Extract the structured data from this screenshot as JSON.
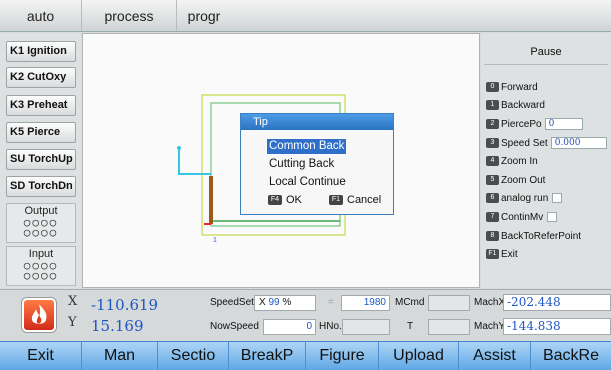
{
  "top_tabs": [
    "auto",
    "process",
    "progr"
  ],
  "left_buttons": [
    "K1 Ignition",
    "K2 CutOxy",
    "K3 Preheat",
    "K5 Pierce",
    "SU TorchUp",
    "SD TorchDn"
  ],
  "output": {
    "label": "Output",
    "dots": "○○○○\n○○○○"
  },
  "input": {
    "label": "Input",
    "dots": "○○○○\n○○○○"
  },
  "canvas": {
    "start_marker": "1"
  },
  "tip_dialog": {
    "title": "Tip",
    "options": [
      "Common Back",
      "Cutting Back",
      "Local Continue"
    ],
    "selected": "Common Back",
    "ok_key": "F4",
    "ok_label": "OK",
    "cancel_key": "F1",
    "cancel_label": "Cancel"
  },
  "right_panel": {
    "title": "Pause",
    "items": [
      {
        "key": "0",
        "label": "Forward"
      },
      {
        "key": "1",
        "label": "Backward"
      },
      {
        "key": "2",
        "label": "PiercePo",
        "value": "0"
      },
      {
        "key": "3",
        "label": "Speed Set",
        "value": "0.000"
      },
      {
        "key": "4",
        "label": "Zoom In"
      },
      {
        "key": "5",
        "label": "Zoom Out"
      },
      {
        "key": "6",
        "label": "analog run"
      },
      {
        "key": "7",
        "label": "ContinMv"
      },
      {
        "key": "8",
        "label": "BackToReferPoint"
      },
      {
        "key": "F1",
        "label": "Exit"
      }
    ]
  },
  "status": {
    "x_label": "X",
    "y_label": "Y",
    "x_value": "-110.619",
    "y_value": "15.169",
    "speedset_label": "SpeedSet",
    "speedset_x": "X",
    "speedset_pct": "99",
    "pct_sign": "%",
    "eq": "=",
    "speedset_value": "1980",
    "mcmd_label": "MCmd",
    "nowspeed_label": "NowSpeed",
    "nowspeed_value": "0",
    "hno_label": "HNo.",
    "t_label": "T",
    "machx_label": "MachX",
    "machx_value": "-202.448",
    "machy_label": "MachY",
    "machy_value": "-144.838"
  },
  "bottom_buttons": [
    "Exit",
    "Man",
    "Sectio",
    "BreakP",
    "Figure",
    "Upload",
    "Assist",
    "BackRe"
  ],
  "colors": {
    "accent": "#2b73c1",
    "value_blue": "#1e55c4",
    "bottom_bar": "#5ea7e4"
  }
}
